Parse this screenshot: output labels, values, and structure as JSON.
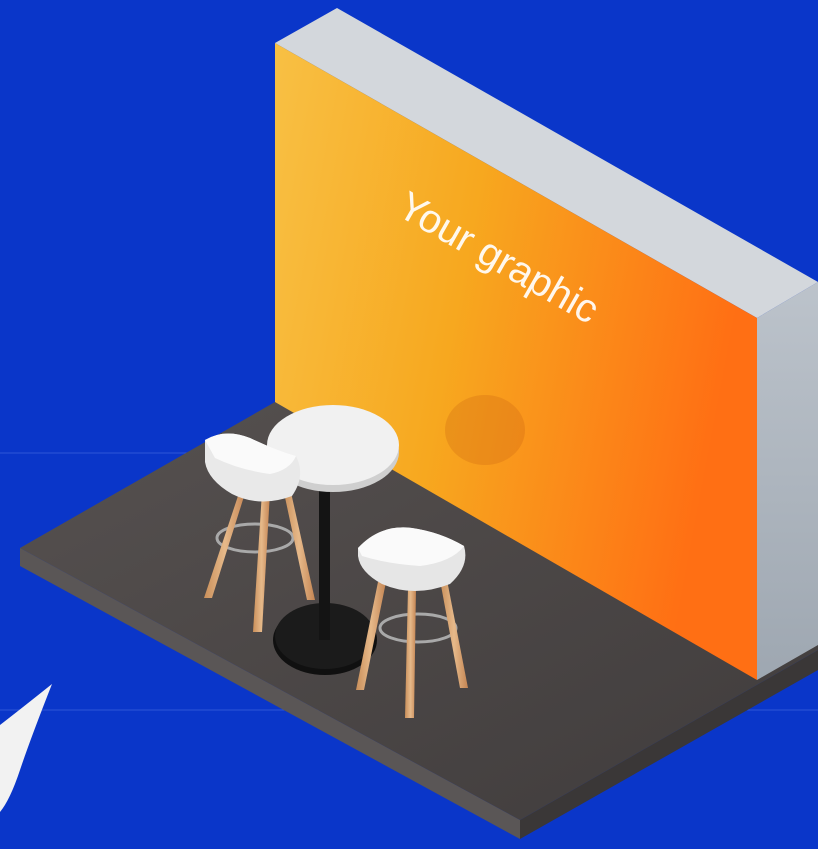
{
  "scene": {
    "background_color": "#0a36c9",
    "wall_graphic_text": "Your graphic",
    "wall_graphic_colors": [
      "#f7b43a",
      "#ff7a1a"
    ],
    "wall_frame_color": "#cfd3d8",
    "floor_color": "#4a4646",
    "furniture": [
      "round-bar-table",
      "bar-stool",
      "bar-stool"
    ]
  }
}
